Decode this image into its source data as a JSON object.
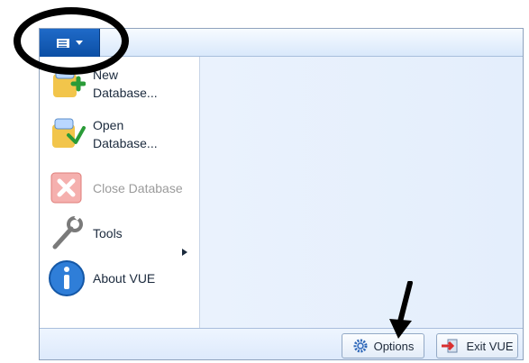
{
  "ribbon": {
    "app_menu_icon": "menu-icon",
    "dropdown_icon": "caret-down-icon"
  },
  "menu": {
    "items": [
      {
        "label": "New\nDatabase...",
        "icon": "new-database-icon",
        "enabled": true
      },
      {
        "label": "Open\nDatabase...",
        "icon": "open-database-icon",
        "enabled": true
      },
      {
        "label": "Close Database",
        "icon": "close-database-icon",
        "enabled": false
      },
      {
        "label": "Tools",
        "icon": "wrench-icon",
        "enabled": true,
        "submenu_icon": "chevron-right-icon"
      },
      {
        "label": "About VUE",
        "icon": "info-icon",
        "enabled": true
      }
    ]
  },
  "footer": {
    "options_label": "Options",
    "options_icon": "gear-icon",
    "exit_label": "Exit VUE",
    "exit_icon": "exit-icon"
  },
  "annotations": {
    "highlight_circle": "callout-circle",
    "pointer_arrow": "pointer-arrow"
  },
  "colors": {
    "accent": "#0c4fa5",
    "pane": "#e7f0fd",
    "window_border": "#8fa2bd",
    "disabled_text": "#9b9b9b"
  }
}
